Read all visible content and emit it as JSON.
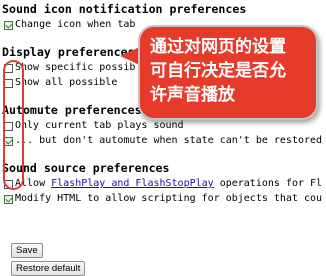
{
  "sections": {
    "sound_icon": {
      "heading": "Sound icon notification preferences",
      "change_icon_label": "Change icon when tab"
    },
    "display": {
      "heading": "Display preferences",
      "show_specific_label": "Show specific possib",
      "show_all_label": "Show all possible"
    },
    "automute": {
      "heading": "Automute preferences",
      "only_current_label": "Only current tab plays sound",
      "dont_automute_label": "... but don't automute when state can't be restored"
    },
    "sound_source": {
      "heading": "Sound source preferences",
      "allow_prefix": "Allow ",
      "flashplay_link": "FlashPlay and FlashStopPlay",
      "allow_suffix": " operations for Fl",
      "modify_html_label": "Modify HTML to allow scripting for objects that cou"
    }
  },
  "buttons": {
    "save": "Save",
    "restore_default": "Restore default"
  },
  "annotation": {
    "line1": "通过对网页的设置",
    "line2": "可自行决定是否允",
    "line3": "许声音播放"
  },
  "checkbox_states": {
    "change_icon": true,
    "show_specific": false,
    "show_all": false,
    "only_current": false,
    "dont_automute": true,
    "allow_flashplay": false,
    "modify_html": true
  },
  "colors": {
    "callout_bg": "#e63b2b",
    "highlight_border": "#e53935",
    "link": "#1a0dab"
  }
}
